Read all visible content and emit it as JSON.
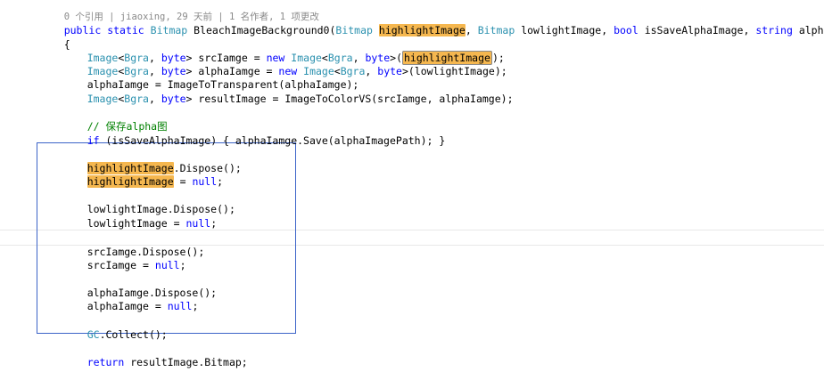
{
  "codelens": "0 个引用 | jiaoxing, 29 天前 | 1 名作者, 1 项更改",
  "lines": {
    "sig_public": "public",
    "sig_static": "static",
    "sig_type": "Bitmap",
    "sig_name": "BleachImageBackground0(",
    "sig_p1_type": "Bitmap",
    "sig_p1_name": "highlightImage",
    "sig_sep1": ",",
    "sig_p2_type": "Bitmap",
    "sig_p2_name": "lowlightImage,",
    "sig_p3_type": "bool",
    "sig_p3_name": "isSaveAlphaImage,",
    "sig_p4_type": "string",
    "sig_p4_name": "alphaImagePath)",
    "brace_open": "{",
    "l1_t1": "Image",
    "l1_t2": "<",
    "l1_t3": "Bgra",
    "l1_t4": ",",
    "l1_t5": "byte",
    "l1_t6": "> srcIamge =",
    "l1_new": "new",
    "l1_t7": "Image",
    "l1_t8": "<",
    "l1_t9": "Bgra",
    "l1_t10": ",",
    "l1_t11": "byte",
    "l1_t12": ">(",
    "l1_t13": "highlightImage",
    "l1_t14": ");",
    "l2_t1": "Image",
    "l2_t2": "<",
    "l2_t3": "Bgra",
    "l2_t4": ",",
    "l2_t5": "byte",
    "l2_t6": "> alphaIamge =",
    "l2_new": "new",
    "l2_t7": "Image",
    "l2_t8": "<",
    "l2_t9": "Bgra",
    "l2_t10": ",",
    "l2_t11": "byte",
    "l2_t12": ">(lowlightImage);",
    "l3": "alphaIamge = ImageToTransparent(alphaIamge);",
    "l4_t1": "Image",
    "l4_t2": "<",
    "l4_t3": "Bgra",
    "l4_t4": ",",
    "l4_t5": "byte",
    "l4_t6": "> resultImage = ImageToColorVS(srcIamge, alphaIamge);",
    "comment": "// 保存alpha图",
    "if_kw": "if",
    "if_rest": "(isSaveAlphaImage) { alphaIamge.Save(alphaImagePath); }",
    "d1_var": "highlightImage",
    "d1_rest": ".Dispose();",
    "d2_var": "highlightImage",
    "d2_eq": " =",
    "d2_null": "null",
    "d2_end": ";",
    "d3": "lowlightImage.Dispose();",
    "d4_a": "lowlightImage =",
    "d4_null": "null",
    "d4_end": ";",
    "d5": "srcIamge.Dispose();",
    "d6_a": "srcIamge =",
    "d6_null": "null",
    "d6_end": ";",
    "d7": "alphaIamge.Dispose();",
    "d8_a": "alphaIamge =",
    "d8_null": "null",
    "d8_end": ";",
    "gc_type": "GC",
    "gc_rest": ".Collect();",
    "ret_kw": "return",
    "ret_rest": "resultImage.Bitmap;",
    "brace_close": "}"
  },
  "colors": {
    "keyword": "#0000ff",
    "type": "#2b91af",
    "comment": "#008000",
    "highlight": "#f5b74f",
    "selection_border": "#3c64c8"
  }
}
